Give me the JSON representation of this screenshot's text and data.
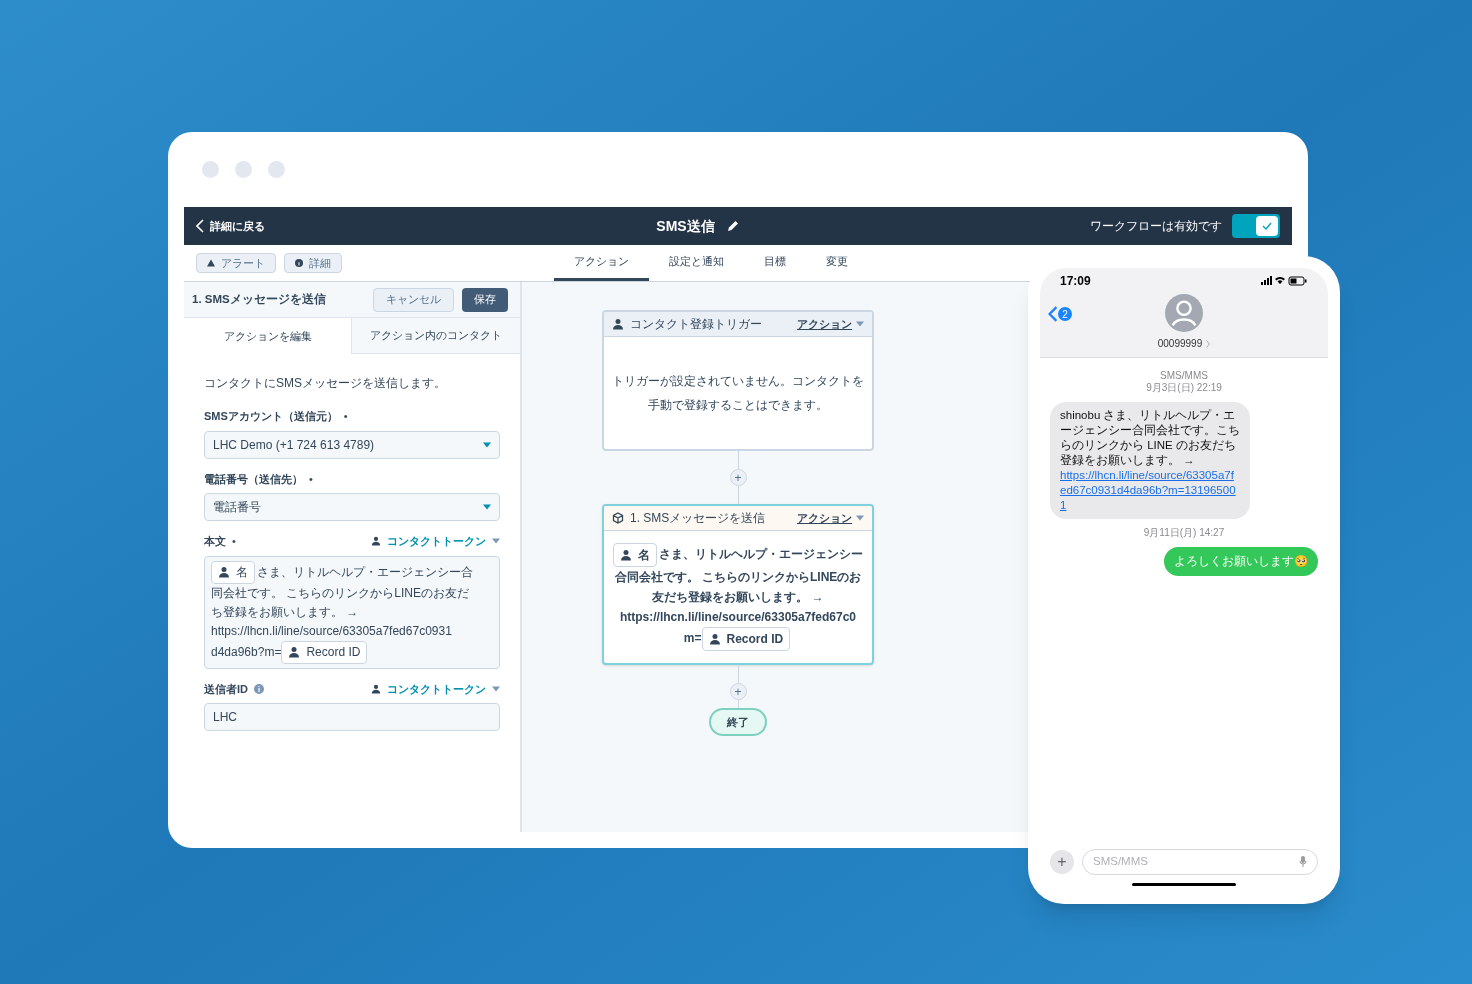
{
  "header": {
    "back": "詳細に戻る",
    "title": "SMS送信",
    "status": "ワークフローは有効です",
    "enabled": true
  },
  "toolbar": {
    "buttons": [
      "アラート",
      "詳細"
    ],
    "tabs": [
      {
        "label": "アクション",
        "selected": true
      },
      {
        "label": "設定と通知",
        "selected": false
      },
      {
        "label": "目標",
        "selected": false
      },
      {
        "label": "変更",
        "selected": false
      }
    ]
  },
  "panel": {
    "title": "1. SMSメッセージを送信",
    "cancel": "キャンセル",
    "save": "保存",
    "tabs": [
      {
        "label": "アクションを編集",
        "selected": true
      },
      {
        "label": "アクション内のコンタクト",
        "selected": false
      }
    ],
    "description": "コンタクトにSMSメッセージを送信します。",
    "fields": [
      {
        "kind": "select",
        "label": "SMSアカウント（送信元）",
        "required_mark": "•",
        "value": "LHC Demo (+1 724 613 4789)"
      },
      {
        "kind": "select",
        "label": "電話番号（送信先）",
        "required_mark": "•",
        "value": "電話番号"
      },
      {
        "kind": "message",
        "label": "本文",
        "required_mark": "•",
        "token_link": "コンタクトトークン",
        "segments": [
          {
            "kind": "token",
            "text": "名"
          },
          {
            "kind": "text",
            "text": "さま、リトルヘルプ・エージェンシー合"
          },
          {
            "kind": "break"
          },
          {
            "kind": "text",
            "text": "同会社です。 こちらのリンクからLINEのお友だ"
          },
          {
            "kind": "break"
          },
          {
            "kind": "text",
            "text": "ち登録をお願いします。 →"
          },
          {
            "kind": "break"
          },
          {
            "kind": "text",
            "text": "https://lhcn.li/line/source/63305a7fed67c0931"
          },
          {
            "kind": "break"
          },
          {
            "kind": "text",
            "text": "d4da96b?m="
          },
          {
            "kind": "token",
            "text": "Record ID"
          }
        ]
      },
      {
        "kind": "text",
        "label": "送信者ID",
        "info": true,
        "token_link": "コンタクトトークン",
        "value": "LHC"
      }
    ]
  },
  "flow": {
    "add_button": "+",
    "nodes": [
      {
        "kind": "trigger",
        "title": "コンタクト登録トリガー",
        "menu": "アクション",
        "selected": false,
        "body": "トリガーが設定されていません。コンタクトを手動で登録することはできます。"
      },
      {
        "kind": "action",
        "title": "1. SMSメッセージを送信",
        "menu": "アクション",
        "selected": true,
        "segments": [
          {
            "kind": "token",
            "text": "名"
          },
          {
            "kind": "text",
            "text": "さま、リトルヘルプ・エージェンシー"
          },
          {
            "kind": "break"
          },
          {
            "kind": "text",
            "text": "合同会社です。 こちらのリンクからLINEのお"
          },
          {
            "kind": "break"
          },
          {
            "kind": "text",
            "text": "友だち登録をお願いします。 →"
          },
          {
            "kind": "break"
          },
          {
            "kind": "text",
            "text": "https://lhcn.li/line/source/63305a7fed67c0"
          },
          {
            "kind": "break"
          },
          {
            "kind": "text",
            "text": "m="
          },
          {
            "kind": "token",
            "text": "Record ID"
          }
        ]
      }
    ],
    "end": "終了"
  },
  "phone": {
    "time": "17:09",
    "back_badge": "2",
    "contact": "00099999",
    "add_button": "+",
    "messages": [
      {
        "kind": "stamp",
        "lines": [
          "SMS/MMS",
          "9月3日(日) 22:19"
        ]
      },
      {
        "kind": "incoming",
        "text": "shinobu さま、リトルヘルプ・エージェンシー合同会社です。こちらのリンクから LINE のお友だち登録をお願いします。 →",
        "link": "https://lhcn.li/line/source/63305a7fed67c0931d4da96b?m=131965001"
      },
      {
        "kind": "stamp",
        "lines": [
          "9月11日(月) 14:27"
        ]
      },
      {
        "kind": "outgoing",
        "text": "よろしくお願いします🥺"
      }
    ],
    "input": {
      "placeholder": "SMS/MMS"
    }
  }
}
